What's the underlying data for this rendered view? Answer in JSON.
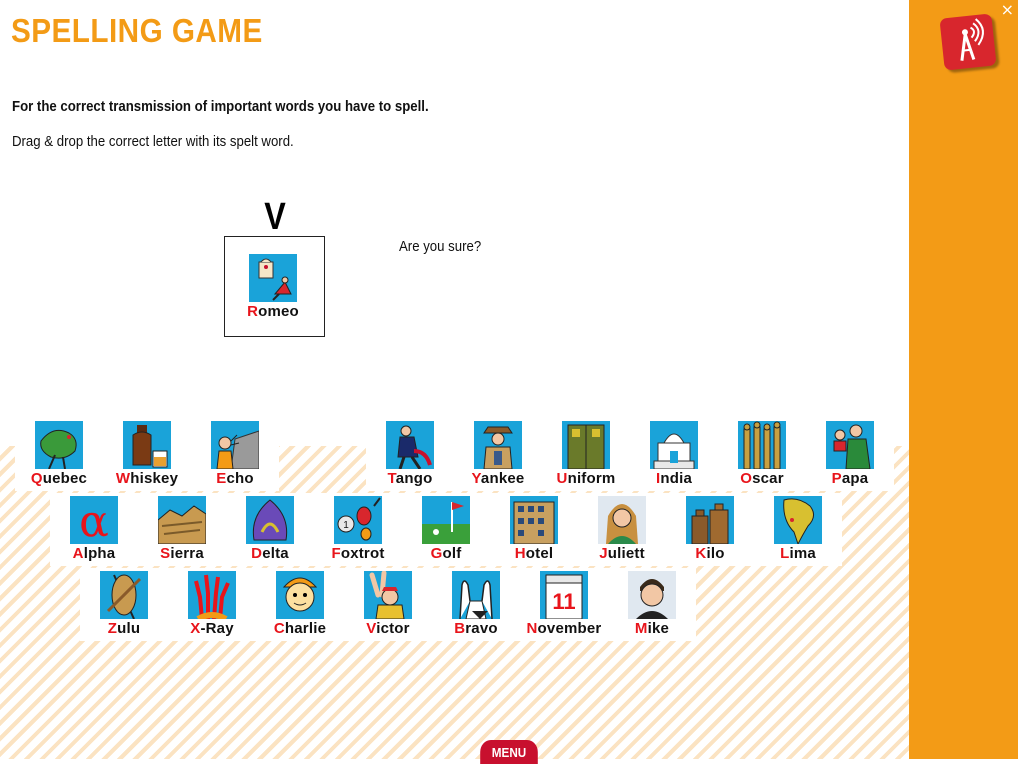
{
  "header": {
    "title": "SPELLING GAME"
  },
  "instructions": {
    "intro": "For the correct transmission of important words you have to spell.",
    "task": "Drag & drop the correct letter with its spelt word."
  },
  "challenge": {
    "letter": "V",
    "dropped_card": {
      "initial": "R",
      "rest": "omeo",
      "icon": "romeo-icon"
    },
    "feedback": "Are you sure?"
  },
  "cards_row1": [
    {
      "initial": "Q",
      "rest": "uebec",
      "icon": "quebec-icon"
    },
    {
      "initial": "W",
      "rest": "hiskey",
      "icon": "whiskey-icon"
    },
    {
      "initial": "E",
      "rest": "cho",
      "icon": "echo-icon"
    },
    {
      "initial": "T",
      "rest": "ango",
      "icon": "tango-icon"
    },
    {
      "initial": "Y",
      "rest": "ankee",
      "icon": "yankee-icon"
    },
    {
      "initial": "U",
      "rest": "niform",
      "icon": "uniform-icon"
    },
    {
      "initial": "I",
      "rest": "ndia",
      "icon": "india-icon"
    },
    {
      "initial": "O",
      "rest": "scar",
      "icon": "oscar-icon"
    },
    {
      "initial": "P",
      "rest": "apa",
      "icon": "papa-icon"
    }
  ],
  "cards_row2": [
    {
      "initial": "A",
      "rest": "lpha",
      "icon": "alpha-icon"
    },
    {
      "initial": "S",
      "rest": "ierra",
      "icon": "sierra-icon"
    },
    {
      "initial": "D",
      "rest": "elta",
      "icon": "delta-icon"
    },
    {
      "initial": "F",
      "rest": "oxtrot",
      "icon": "foxtrot-icon"
    },
    {
      "initial": "G",
      "rest": "olf",
      "icon": "golf-icon"
    },
    {
      "initial": "H",
      "rest": "otel",
      "icon": "hotel-icon"
    },
    {
      "initial": "J",
      "rest": "uliett",
      "icon": "juliett-icon"
    },
    {
      "initial": "K",
      "rest": "ilo",
      "icon": "kilo-icon"
    },
    {
      "initial": "L",
      "rest": "ima",
      "icon": "lima-icon"
    }
  ],
  "cards_row3": [
    {
      "initial": "Z",
      "rest": "ulu",
      "icon": "zulu-icon"
    },
    {
      "initial": "X",
      "rest": "-Ray",
      "icon": "xray-icon"
    },
    {
      "initial": "C",
      "rest": "harlie",
      "icon": "charlie-icon"
    },
    {
      "initial": "V",
      "rest": "ictor",
      "icon": "victor-icon"
    },
    {
      "initial": "B",
      "rest": "ravo",
      "icon": "bravo-icon"
    },
    {
      "initial": "N",
      "rest": "ovember",
      "icon": "november-icon"
    },
    {
      "initial": "M",
      "rest": "ike",
      "icon": "mike-icon"
    }
  ],
  "sidebar": {
    "close_label": "×",
    "logo_icon": "radio-tower-icon"
  },
  "footer": {
    "menu_label": "MENU"
  },
  "colors": {
    "accent": "#f39b16",
    "initial_letter": "#e8141b",
    "picture_bg": "#1aa3d9",
    "menu": "#c8102e"
  }
}
